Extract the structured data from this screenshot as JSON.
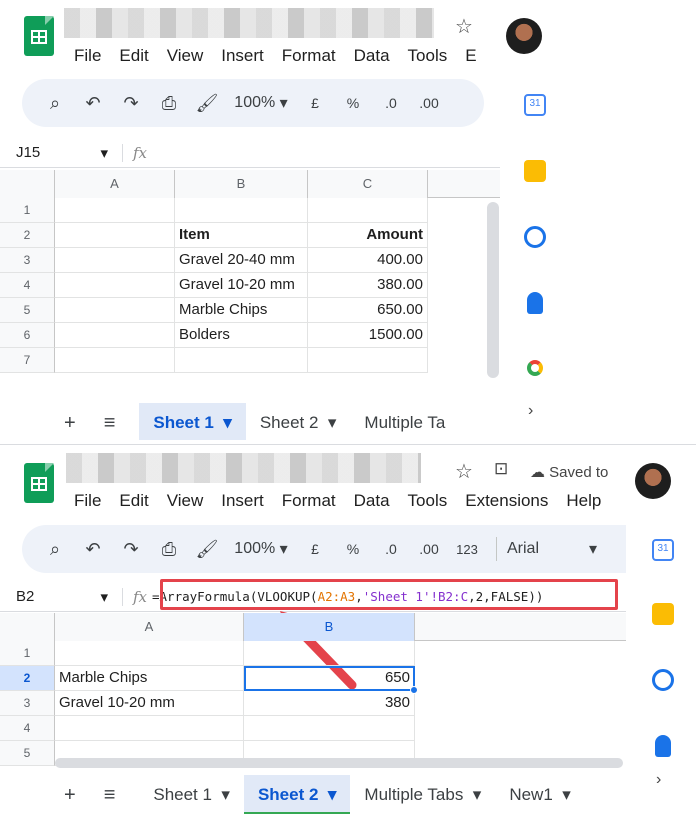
{
  "pane1": {
    "menu": [
      "File",
      "Edit",
      "View",
      "Insert",
      "Format",
      "Data",
      "Tools",
      "E"
    ],
    "toolbar": {
      "zoom": "100%",
      "currency": "£",
      "percent": "%",
      "dec_decrease": ".0",
      "dec_increase": ".00"
    },
    "name_box": "J15",
    "fx": "fx",
    "columns": [
      "A",
      "B",
      "C"
    ],
    "rows": [
      "1",
      "2",
      "3",
      "4",
      "5",
      "6",
      "7"
    ],
    "cells": [
      [
        "",
        "",
        ""
      ],
      [
        "",
        "Item",
        "Amount"
      ],
      [
        "",
        "Gravel 20-40 mm",
        "400.00"
      ],
      [
        "",
        "Gravel 10-20 mm",
        "380.00"
      ],
      [
        "",
        "Marble Chips",
        "650.00"
      ],
      [
        "",
        "Bolders",
        "1500.00"
      ],
      [
        "",
        "",
        ""
      ]
    ],
    "tabs": [
      "Sheet 1",
      "Sheet 2",
      "Multiple Ta"
    ],
    "add_sheet": "+",
    "all_sheets": "≡"
  },
  "pane2": {
    "menu": [
      "File",
      "Edit",
      "View",
      "Insert",
      "Format",
      "Data",
      "Tools",
      "Extensions",
      "Help"
    ],
    "saved": "Saved to",
    "toolbar": {
      "zoom": "100%",
      "currency": "£",
      "percent": "%",
      "dec_decrease": ".0",
      "dec_increase": ".00",
      "number_format": "123",
      "font": "Arial"
    },
    "name_box": "B2",
    "fx": "fx",
    "formula_parts": [
      {
        "text": "=ArrayFormula(VLOOKUP(",
        "color": "#1f1f1f"
      },
      {
        "text": "A2:A3",
        "color": "#e37400"
      },
      {
        "text": ",",
        "color": "#1f1f1f"
      },
      {
        "text": "'Sheet 1'!B2:C",
        "color": "#8430ce"
      },
      {
        "text": ",2,FALSE))",
        "color": "#1f1f1f"
      }
    ],
    "columns": [
      "A",
      "B"
    ],
    "rows": [
      "1",
      "2",
      "3",
      "4",
      "5"
    ],
    "cells": [
      [
        "",
        ""
      ],
      [
        "Marble Chips",
        "650"
      ],
      [
        "Gravel 10-20 mm",
        "380"
      ],
      [
        "",
        ""
      ],
      [
        "",
        ""
      ]
    ],
    "tabs": [
      "Sheet 1",
      "Sheet 2",
      "Multiple Tabs",
      "New1"
    ],
    "add_sheet": "+",
    "all_sheets": "≡"
  },
  "side_icons": [
    "calendar-icon",
    "keep-icon",
    "tasks-icon",
    "contacts-icon",
    "maps-icon"
  ],
  "calendar_day": "31",
  "colors": {
    "accent": "#0b57d0",
    "sheet2_tab": "#34a853",
    "callout": "#e4434b",
    "selection": "#1a73e8"
  }
}
